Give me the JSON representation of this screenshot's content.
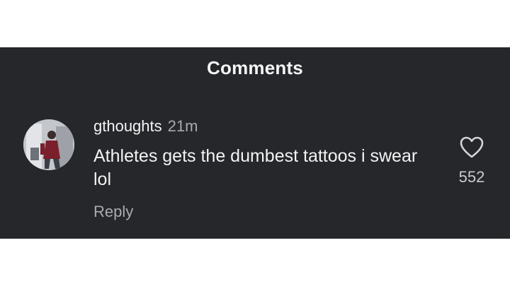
{
  "header": {
    "title": "Comments"
  },
  "comment": {
    "avatar_icon": "user-avatar",
    "username": "gthoughts",
    "timestamp": "21m",
    "text": "Athletes gets the dumbest tattoos i swear lol",
    "reply_label": "Reply",
    "like_icon": "heart-outline-icon",
    "like_count": "552"
  },
  "colors": {
    "background": "#25272b",
    "primary_text": "#f3f3f3",
    "secondary_text": "#a9abb0"
  }
}
